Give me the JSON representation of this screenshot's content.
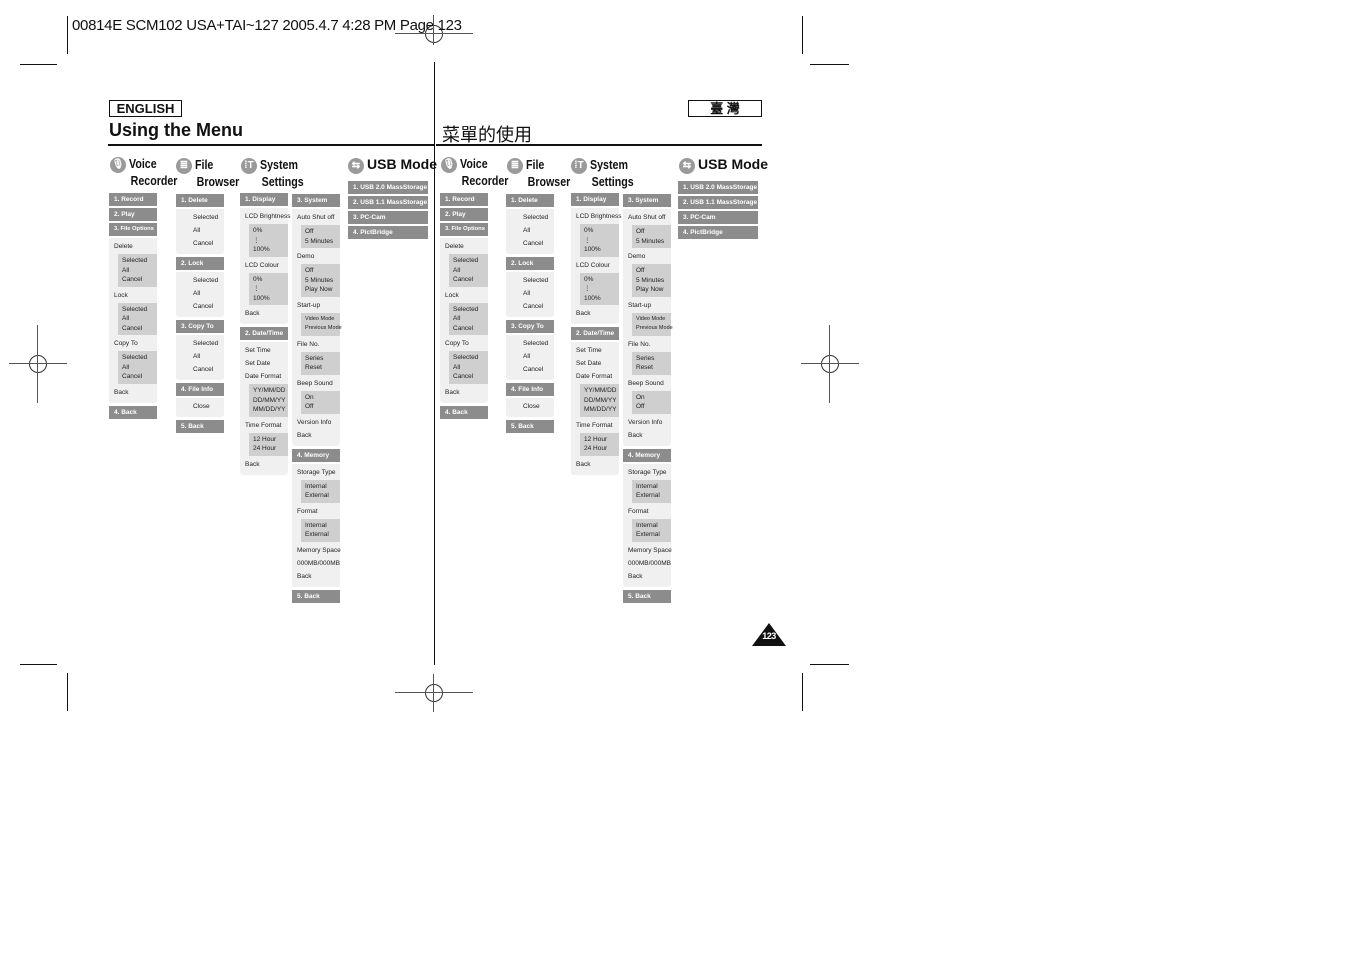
{
  "slug": "00814E SCM102  USA+TAI~127  2005.4.7  4:28 PM  Page 123",
  "page_number": "123",
  "left": {
    "lang_label": "ENGLISH",
    "title": "Using the Menu"
  },
  "right": {
    "lang_label": "臺 灣",
    "title": "菜單的使用"
  },
  "sections": {
    "voice": {
      "line1": "Voice",
      "line2": "Recorder",
      "icon": "microphone-icon"
    },
    "file": {
      "line1": "File",
      "line2": "Browser",
      "icon": "document-icon"
    },
    "system": {
      "line1": "System",
      "line2": "Settings",
      "icon": "settings-icon"
    },
    "usb": {
      "label": "USB Mode",
      "icon": "usb-icon"
    }
  },
  "voice_recorder": {
    "record": "1. Record",
    "play": "2. Play",
    "file_options": "3. File Options",
    "delete": "Delete",
    "delete_opts": [
      "Selected",
      "All",
      "Cancel"
    ],
    "lock": "Lock",
    "lock_opts": [
      "Selected",
      "All",
      "Cancel"
    ],
    "copy_to": "Copy To",
    "copy_opts": [
      "Selected",
      "All",
      "Cancel"
    ],
    "back": "Back",
    "back4": "4. Back"
  },
  "file_browser": {
    "delete": "1. Delete",
    "delete_opts": [
      "Selected",
      "All",
      "Cancel"
    ],
    "lock": "2. Lock",
    "lock_opts": [
      "Selected",
      "All",
      "Cancel"
    ],
    "copy_to": "3. Copy To",
    "copy_opts": [
      "Selected",
      "All",
      "Cancel"
    ],
    "file_info": "4. File Info",
    "close": "Close",
    "back5": "5. Back"
  },
  "system_settings": {
    "display": "1. Display",
    "lcd_brightness": "LCD Brightness",
    "brightness_opts": [
      "0%",
      "⋮",
      "100%"
    ],
    "lcd_colour": "LCD Colour",
    "colour_opts": [
      "0%",
      "⋮",
      "100%"
    ],
    "display_back": "Back",
    "date_time": "2. Date/Time",
    "set_time": "Set Time",
    "set_date": "Set Date",
    "date_format": "Date Format",
    "date_format_opts": [
      "YY/MM/DD",
      "DD/MM/YY",
      "MM/DD/YY"
    ],
    "time_format": "Time Format",
    "time_format_opts": [
      "12 Hour",
      "24 Hour"
    ],
    "date_back": "Back",
    "system": "3. System",
    "auto_shut_off": "Auto Shut off",
    "auto_opts": [
      "Off",
      "5 Minutes"
    ],
    "demo": "Demo",
    "demo_opts": [
      "Off",
      "5 Minutes",
      "Play Now"
    ],
    "startup": "Start-up",
    "startup_opts": [
      "Video Mode",
      "Previous Mode"
    ],
    "file_no": "File No.",
    "file_no_opts": [
      "Series",
      "Reset"
    ],
    "beep_sound": "Beep Sound",
    "beep_opts": [
      "On",
      "Off"
    ],
    "version_info": "Version Info",
    "system_back": "Back",
    "memory": "4. Memory",
    "storage_type": "Storage Type",
    "storage_opts": [
      "Internal",
      "External"
    ],
    "format": "Format",
    "format_opts": [
      "Internal",
      "External"
    ],
    "memory_space": "Memory Space",
    "memory_value": "000MB/000MB",
    "memory_back": "Back",
    "back5": "5. Back"
  },
  "usb_mode": {
    "items": [
      "1. USB 2.0 MassStorage",
      "2. USB 1.1 MassStorage",
      "3. PC-Cam",
      "4. PictBridge"
    ]
  }
}
